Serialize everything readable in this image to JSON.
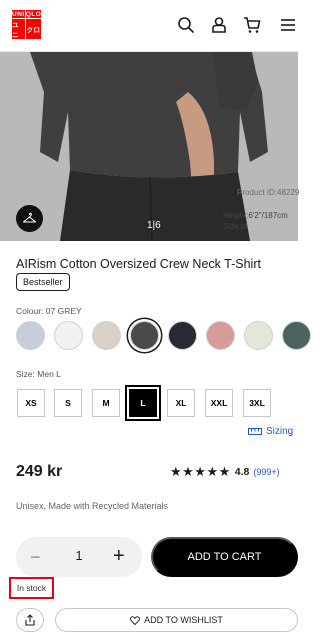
{
  "header": {
    "logo_letters": [
      "UNI",
      "QLO",
      "ユニ",
      "クロ"
    ],
    "icons": [
      "search-icon",
      "account-icon",
      "cart-icon",
      "menu-icon"
    ]
  },
  "gallery": {
    "pager_text": "1|6",
    "product_id_text": "Product ID:48229",
    "model_height_text": "Height:6'2\"/187cm",
    "model_size_text": "Size:M"
  },
  "product": {
    "title": "AIRism Cotton Oversized Crew Neck T-Shirt",
    "badge": "Bestseller",
    "colour_label": "Colour: 07 GREY",
    "colours": [
      {
        "name": "light-blue-grey",
        "hex": "#c7ced9"
      },
      {
        "name": "white",
        "hex": "#f1f1f1"
      },
      {
        "name": "beige",
        "hex": "#d9d0c7"
      },
      {
        "name": "grey",
        "hex": "#4a4a4a",
        "selected": true
      },
      {
        "name": "navy",
        "hex": "#262a35"
      },
      {
        "name": "pink",
        "hex": "#d79b98"
      },
      {
        "name": "light-green",
        "hex": "#e1e8d8"
      },
      {
        "name": "dark-green",
        "hex": "#4a6360"
      }
    ],
    "size_label": "Size: Men L",
    "sizes": [
      "XS",
      "S",
      "M",
      "L",
      "XL",
      "XXL",
      "3XL"
    ],
    "selected_size": "L",
    "sizing_link": "Sizing",
    "price": "249 kr",
    "rating_score": "4.8",
    "rating_count": "(999+)",
    "stars_text": "★★★★★",
    "material": "Unisex,  Made with Recycled Materials"
  },
  "purchase": {
    "quantity": "1",
    "minus_label": "−",
    "plus_label": "+",
    "add_to_cart": "ADD TO CART",
    "stock_status": "In stock",
    "wishlist": "ADD TO WISHLIST"
  },
  "colors": {
    "brand_red": "#ff0000",
    "link_blue": "#2757c3",
    "highlight_red": "#e60012"
  }
}
